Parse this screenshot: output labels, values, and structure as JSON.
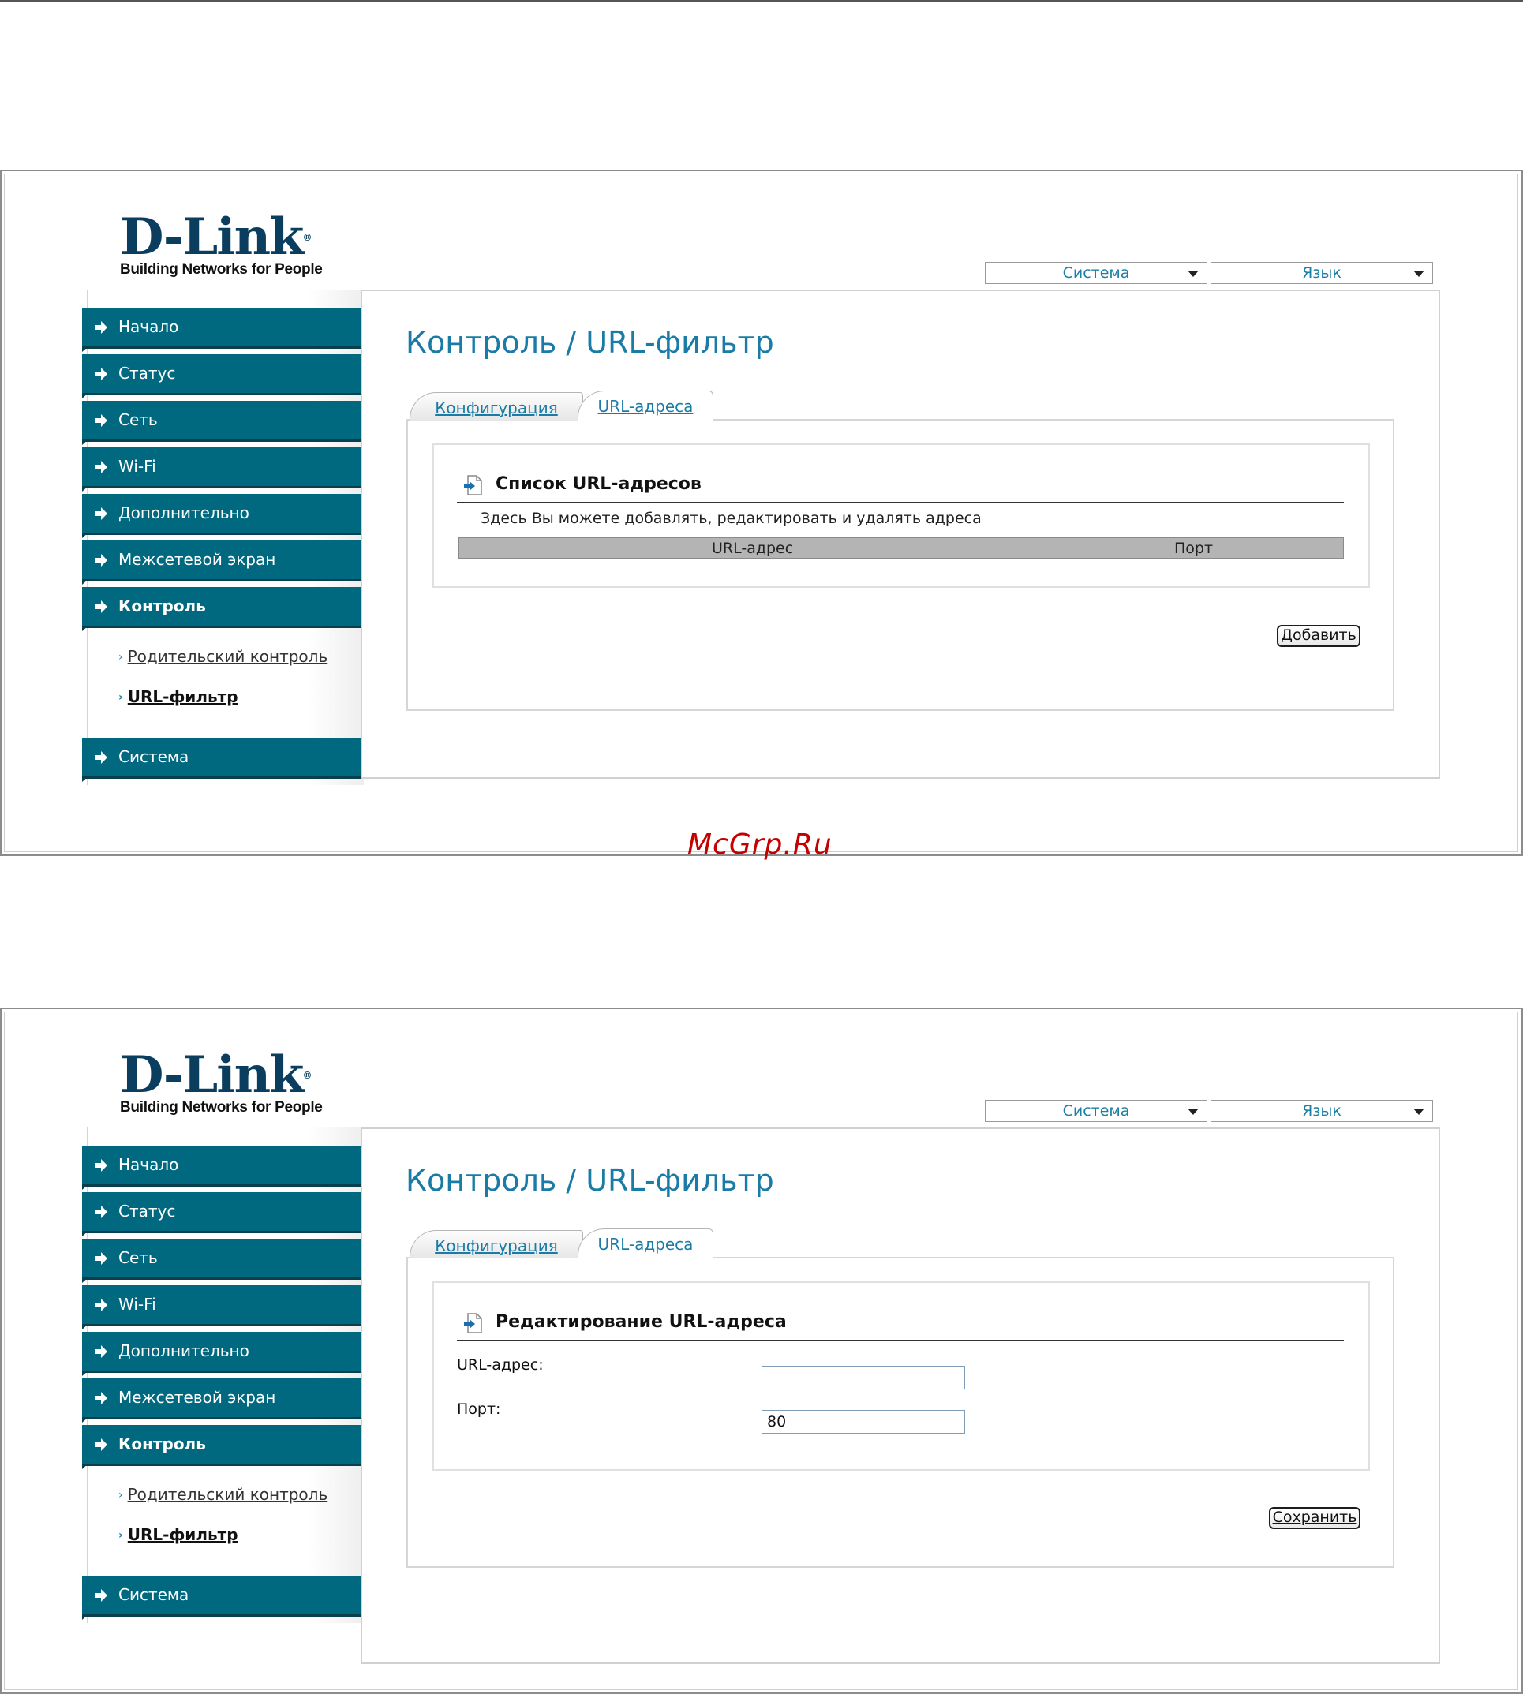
{
  "watermark": "McGrp.Ru",
  "screens": [
    {
      "logo": {
        "text": "D-Link",
        "tagline": "Building Networks for People"
      },
      "top_menu": {
        "system": "Система",
        "language": "Язык"
      },
      "nav": [
        "Начало",
        "Статус",
        "Сеть",
        "Wi-Fi",
        "Дополнительно",
        "Межсетевой экран",
        "Контроль",
        "Система"
      ],
      "subnav": [
        "Родительский контроль",
        "URL-фильтр"
      ],
      "page_title": "Контроль / URL-фильтр",
      "tabs": [
        "Конфигурация",
        "URL-адреса"
      ],
      "section_title": "Список URL-адресов",
      "description": "Здесь Вы можете добавлять, редактировать и удалять адреса",
      "table_headers": [
        "URL-адрес",
        "Порт"
      ],
      "button": "Добавить"
    },
    {
      "logo": {
        "text": "D-Link",
        "tagline": "Building Networks for People"
      },
      "top_menu": {
        "system": "Система",
        "language": "Язык"
      },
      "nav": [
        "Начало",
        "Статус",
        "Сеть",
        "Wi-Fi",
        "Дополнительно",
        "Межсетевой экран",
        "Контроль",
        "Система"
      ],
      "subnav": [
        "Родительский контроль",
        "URL-фильтр"
      ],
      "page_title": "Контроль / URL-фильтр",
      "tabs": [
        "Конфигурация",
        "URL-адреса"
      ],
      "section_title": "Редактирование URL-адреса",
      "fields": [
        {
          "label": "URL-адрес:",
          "value": ""
        },
        {
          "label": "Порт:",
          "value": "80"
        }
      ],
      "button": "Сохранить"
    }
  ]
}
